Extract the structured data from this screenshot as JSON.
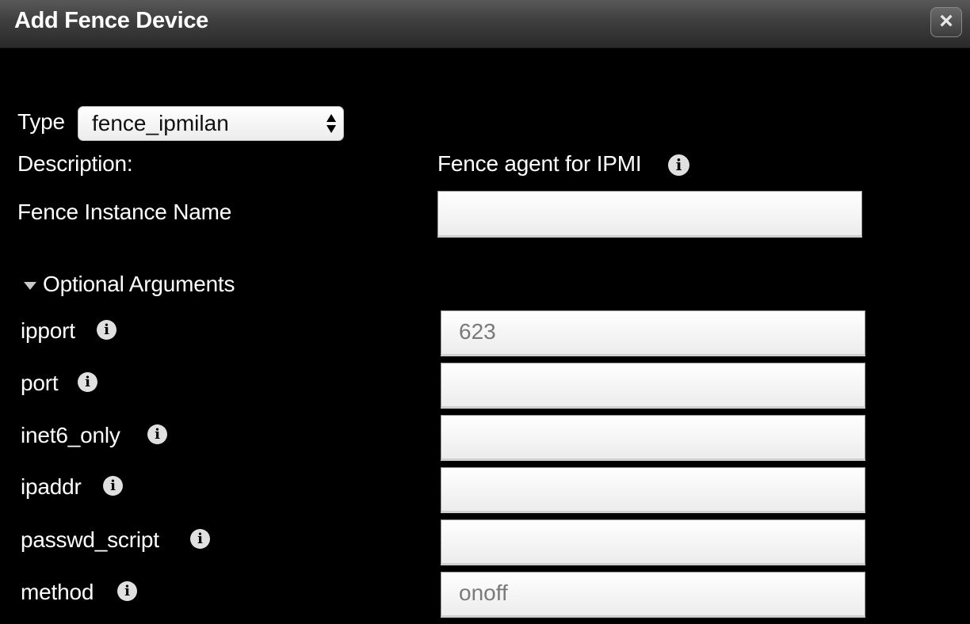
{
  "dialog": {
    "title": "Add Fence Device",
    "close_icon": "close-icon"
  },
  "form": {
    "type_label": "Type",
    "type_value": "fence_ipmilan",
    "description_label": "Description:",
    "description_value": "Fence agent for IPMI",
    "instance_label": "Fence Instance Name",
    "instance_value": ""
  },
  "optional": {
    "heading": "Optional Arguments",
    "expanded": true,
    "fields": [
      {
        "label": "ipport",
        "placeholder": "623"
      },
      {
        "label": "port",
        "placeholder": ""
      },
      {
        "label": "inet6_only",
        "placeholder": ""
      },
      {
        "label": "ipaddr",
        "placeholder": ""
      },
      {
        "label": "passwd_script",
        "placeholder": ""
      },
      {
        "label": "method",
        "placeholder": "onoff"
      }
    ]
  },
  "icons": {
    "info": "info-icon",
    "expand": "triangle-down-icon",
    "select_arrows": "select-arrows-icon"
  },
  "colors": {
    "background": "#000000",
    "titlebar": "#3e3e3e",
    "text": "#ffffff",
    "placeholder": "#7a7a7a"
  }
}
